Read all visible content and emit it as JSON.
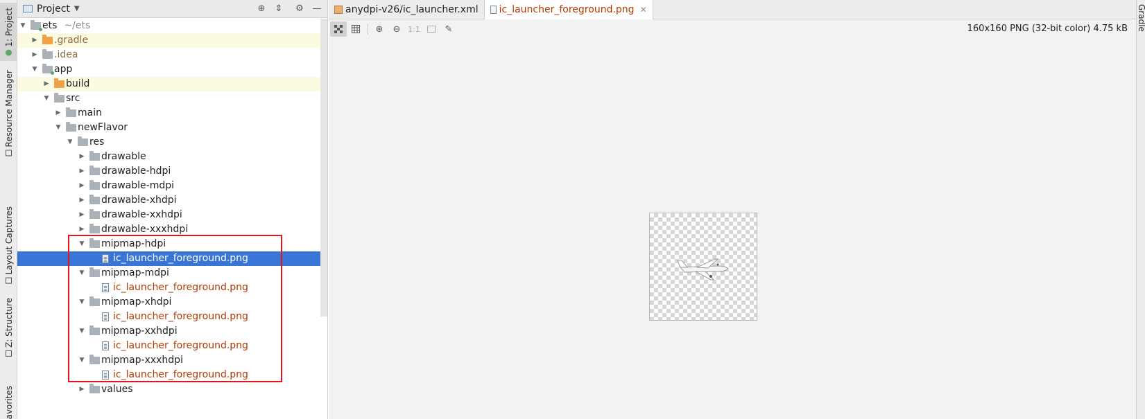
{
  "left_stripe": {
    "tabs": [
      {
        "label": "1: Project",
        "icon": "project-icon"
      },
      {
        "label": "Resource Manager",
        "icon": "resource-manager-icon"
      },
      {
        "label": "Layout Captures",
        "icon": "layout-captures-icon"
      },
      {
        "label": "Z: Structure",
        "icon": "structure-icon"
      },
      {
        "label": "avorites",
        "icon": "favorites-icon"
      }
    ]
  },
  "right_stripe": {
    "label": "Gradle"
  },
  "project_panel": {
    "title": "Project",
    "icons": [
      "locate-icon",
      "collapse-all-icon",
      "gear-icon",
      "minimize-icon"
    ],
    "tree": [
      {
        "label": "ets",
        "hint": "~/ets"
      },
      {
        "label": ".gradle"
      },
      {
        "label": ".idea"
      },
      {
        "label": "app"
      },
      {
        "label": "build"
      },
      {
        "label": "src"
      },
      {
        "label": "main"
      },
      {
        "label": "newFlavor"
      },
      {
        "label": "res"
      },
      {
        "label": "drawable"
      },
      {
        "label": "drawable-hdpi"
      },
      {
        "label": "drawable-mdpi"
      },
      {
        "label": "drawable-xhdpi"
      },
      {
        "label": "drawable-xxhdpi"
      },
      {
        "label": "drawable-xxxhdpi"
      },
      {
        "label": "mipmap-hdpi"
      },
      {
        "label": "ic_launcher_foreground.png"
      },
      {
        "label": "mipmap-mdpi"
      },
      {
        "label": "ic_launcher_foreground.png"
      },
      {
        "label": "mipmap-xhdpi"
      },
      {
        "label": "ic_launcher_foreground.png"
      },
      {
        "label": "mipmap-xxhdpi"
      },
      {
        "label": "ic_launcher_foreground.png"
      },
      {
        "label": "mipmap-xxxhdpi"
      },
      {
        "label": "ic_launcher_foreground.png"
      },
      {
        "label": "values"
      }
    ]
  },
  "editor": {
    "tabs": [
      {
        "label": "anydpi-v26/ic_launcher.xml",
        "active": false
      },
      {
        "label": "ic_launcher_foreground.png",
        "active": true
      }
    ],
    "toolbar": {
      "buttons": [
        "chessboard-icon",
        "grid-icon",
        "zoom-in-icon",
        "zoom-out-icon",
        "1:1",
        "fit-zoom-icon",
        "color-picker-icon"
      ]
    },
    "image_info": "160x160 PNG (32-bit color) 4.75 kB"
  },
  "colors": {
    "selection": "#3875d7",
    "highlight_box": "#e8121c",
    "excluded_folder": "#f0a048",
    "file_text": "#b23a00"
  }
}
